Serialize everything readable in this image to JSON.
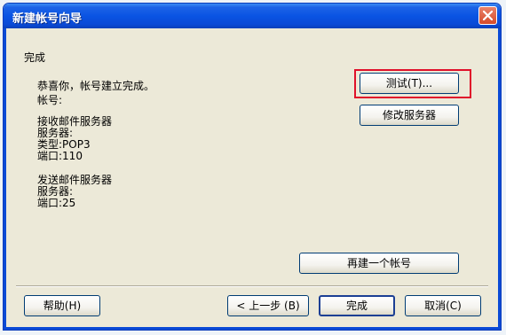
{
  "window": {
    "title": "新建帐号向导",
    "close_label": "×"
  },
  "section_label": "完成",
  "summary": {
    "congrats": "恭喜你，帐号建立完成。",
    "account_label": "帐号:",
    "incoming_header": "接收邮件服务器",
    "incoming_server_label": "服务器:",
    "incoming_type": "类型:POP3",
    "incoming_port": "端口:110",
    "outgoing_header": "发送邮件服务器",
    "outgoing_server_label": "服务器:",
    "outgoing_port": "端口:25"
  },
  "buttons": {
    "test": "测试(T)...",
    "modify_server": "修改服务器",
    "create_another": "再建一个帐号",
    "help": "帮助(H)",
    "back": "< 上一步 (B)",
    "finish": "完成",
    "cancel": "取消(C)"
  },
  "colors": {
    "titlebar": "#0a54e3",
    "dialog_bg": "#ece9d8",
    "highlight_outline": "#e0102a"
  }
}
